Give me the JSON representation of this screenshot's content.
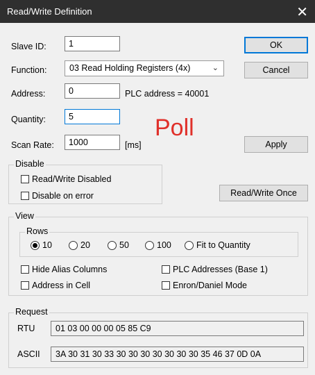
{
  "window": {
    "title": "Read/Write Definition",
    "close_glyph": "✕"
  },
  "form": {
    "slave_id_label": "Slave ID:",
    "slave_id_value": "1",
    "function_label": "Function:",
    "function_value": "03 Read Holding Registers (4x)",
    "address_label": "Address:",
    "address_value": "0",
    "plc_address_text": "PLC address = 40001",
    "quantity_label": "Quantity:",
    "quantity_value": "5",
    "scan_rate_label": "Scan Rate:",
    "scan_rate_value": "1000",
    "scan_rate_unit": "[ms]"
  },
  "buttons": {
    "ok": "OK",
    "cancel": "Cancel",
    "apply": "Apply",
    "read_write_once": "Read/Write Once"
  },
  "overlay_text": "Poll",
  "disable_group": {
    "title": "Disable",
    "read_write_disabled": "Read/Write Disabled",
    "disable_on_error": "Disable on error"
  },
  "view_group": {
    "title": "View",
    "rows_title": "Rows",
    "rows_options": [
      "10",
      "20",
      "50",
      "100",
      "Fit to Quantity"
    ],
    "rows_selected": "10",
    "hide_alias_columns": "Hide Alias Columns",
    "address_in_cell": "Address in Cell",
    "plc_addresses_base1": "PLC Addresses (Base 1)",
    "enron_daniel_mode": "Enron/Daniel Mode"
  },
  "request_group": {
    "title": "Request",
    "rtu_label": "RTU",
    "rtu_value": "01 03 00 00 00 05 85 C9",
    "ascii_label": "ASCII",
    "ascii_value": "3A 30 31 30 33 30 30 30 30 30 30 30 35 46 37 0D 0A"
  }
}
